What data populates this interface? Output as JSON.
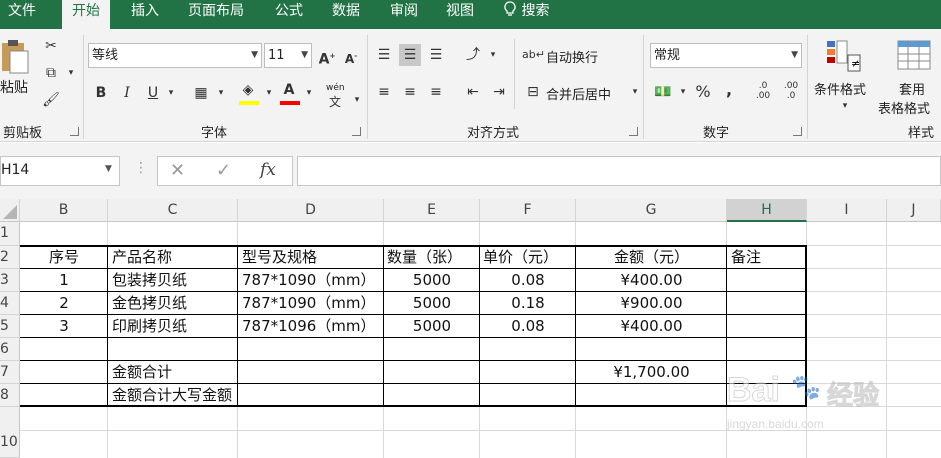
{
  "tabs": [
    "文件",
    "开始",
    "插入",
    "页面布局",
    "公式",
    "数据",
    "审阅",
    "视图",
    "搜索"
  ],
  "ribbon": {
    "clipboard": {
      "paste": "粘贴",
      "group": "剪贴板"
    },
    "font": {
      "name": "等线",
      "size": "11",
      "bold": "B",
      "italic": "I",
      "underline": "U",
      "phonetic": "wén",
      "group": "字体"
    },
    "alignment": {
      "wrap": "自动换行",
      "merge": "合并后居中",
      "group": "对齐方式"
    },
    "number": {
      "format": "常规",
      "percent": "%",
      "comma": ",",
      "group": "数字"
    },
    "styles": {
      "conditional": "条件格式",
      "table_line1": "套用",
      "table_line2": "表格格式",
      "group": "样式"
    }
  },
  "formula_bar": {
    "name_box": "H14",
    "fx": "fx",
    "formula": ""
  },
  "columns": [
    "B",
    "C",
    "D",
    "E",
    "F",
    "G",
    "H",
    "I",
    "J"
  ],
  "rows": [
    "1",
    "2",
    "3",
    "4",
    "5",
    "6",
    "7",
    "8",
    "10"
  ],
  "table": {
    "header": [
      "序号",
      "产品名称",
      "型号及规格",
      "数量（张）",
      "单价（元）",
      "金额（元）",
      "备注"
    ],
    "rows": [
      [
        "1",
        "包装拷贝纸",
        "787*1090（mm）",
        "5000",
        "0.08",
        "¥400.00",
        ""
      ],
      [
        "2",
        "金色拷贝纸",
        "787*1090（mm）",
        "5000",
        "0.18",
        "¥900.00",
        ""
      ],
      [
        "3",
        "印刷拷贝纸",
        "787*1096（mm）",
        "5000",
        "0.08",
        "¥400.00",
        ""
      ]
    ],
    "total_label": "金额合计",
    "total_value": "¥1,700.00",
    "total_caps_label": "金额合计大写金额"
  },
  "watermark": {
    "brand": "Bai",
    "brand2": "经验",
    "url": "jingyan.baidu.com"
  },
  "colors": {
    "excel_green": "#217346",
    "ribbon_bg": "#f3f3f3",
    "highlight_yellow": "#ffff00",
    "font_red": "#ff0000"
  }
}
